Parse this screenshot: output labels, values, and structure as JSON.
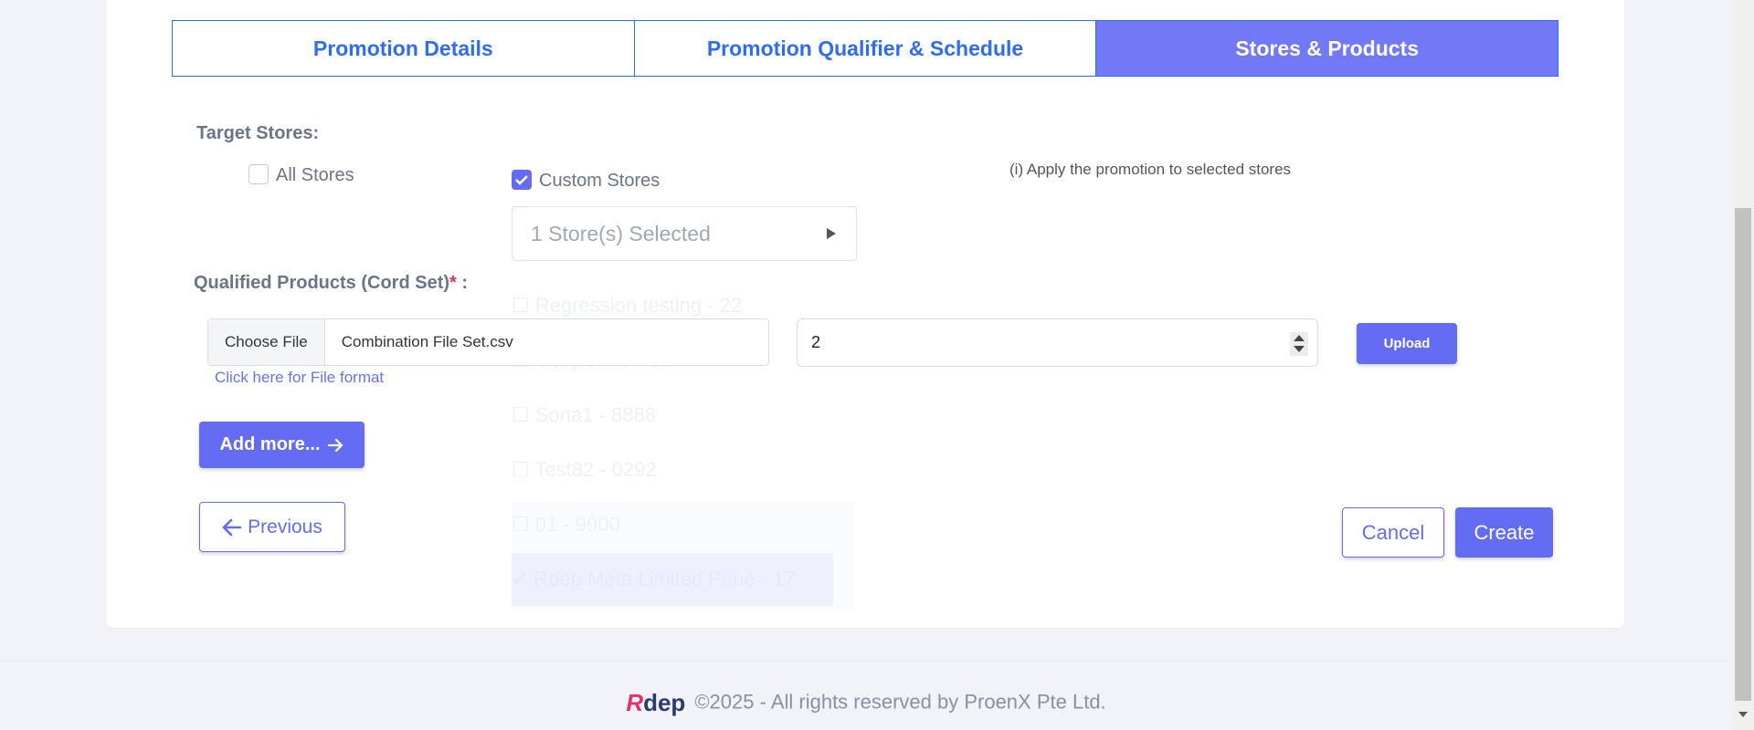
{
  "tabs": [
    {
      "label": "Promotion Details",
      "active": false
    },
    {
      "label": "Promotion Qualifier & Schedule",
      "active": false
    },
    {
      "label": "Stores & Products",
      "active": true
    }
  ],
  "target_stores": {
    "label": "Target Stores:",
    "all_stores": {
      "label": "All Stores",
      "checked": false
    },
    "custom_stores": {
      "label": "Custom Stores",
      "checked": true
    },
    "select_value": "1 Store(s) Selected",
    "info": "(i) Apply the promotion to selected stores"
  },
  "dropdown_ghost_items": [
    "☐ Regression testing - 22",
    "☐ CoopStore - 21",
    "☐ Sona1 - 8888",
    "☐ Test82 - 0292",
    "☐ 01 - 9900",
    "✓ Rdep Meta Limited Pune - 17"
  ],
  "qualified_products": {
    "label": "Qualified Products (Cord Set)",
    "required_mark": "*",
    "label_suffix": " :",
    "choose_file": "Choose File",
    "file_name": "Combination File Set.csv",
    "file_format_link": "Click here for File format",
    "quantity_value": "2",
    "upload_label": "Upload"
  },
  "buttons": {
    "add_more": "Add more...",
    "previous": "Previous",
    "cancel": "Cancel",
    "create": "Create"
  },
  "footer": {
    "logo_r": "R",
    "logo_dep": "dep",
    "text": "©2025 - All rights reserved by ProenX Pte Ltd."
  },
  "colors": {
    "primary": "#636cf2",
    "tab_active": "#7179f6",
    "tab_text": "#2f6cf6",
    "required": "#e5334b"
  }
}
